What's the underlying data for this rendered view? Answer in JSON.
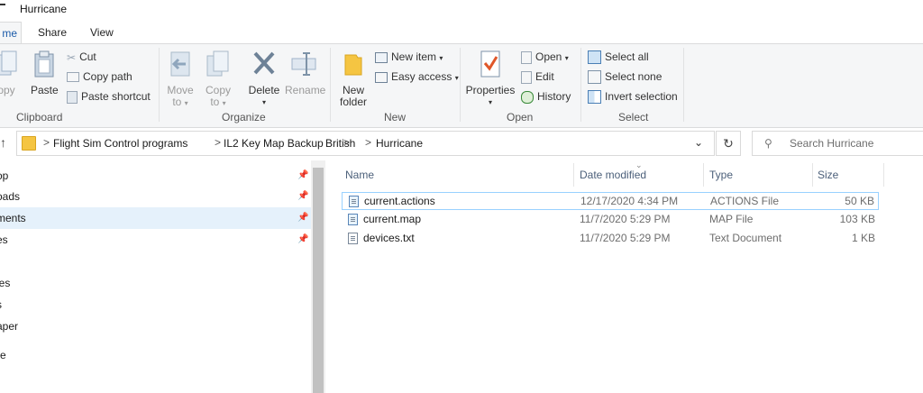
{
  "window": {
    "title": "Hurricane"
  },
  "tabs": {
    "home": "me",
    "share": "Share",
    "view": "View"
  },
  "ribbon": {
    "clipboard": {
      "label": "Clipboard",
      "copy": "opy",
      "paste": "Paste",
      "cut": "Cut",
      "copy_path": "Copy path",
      "paste_shortcut": "Paste shortcut"
    },
    "organize": {
      "label": "Organize",
      "move_to_1": "Move",
      "move_to_2": "to",
      "copy_to_1": "Copy",
      "copy_to_2": "to",
      "delete": "Delete",
      "rename": "Rename"
    },
    "new": {
      "label": "New",
      "new_folder_1": "New",
      "new_folder_2": "folder",
      "new_item": "New item",
      "easy_access": "Easy access"
    },
    "open": {
      "label": "Open",
      "properties": "Properties",
      "open": "Open",
      "edit": "Edit",
      "history": "History"
    },
    "select": {
      "label": "Select",
      "select_all": "Select all",
      "select_none": "Select none",
      "invert_selection": "Invert selection"
    }
  },
  "address": {
    "crumbs": [
      "Flight Sim Control programs",
      "IL2 Key Map Backup",
      "British",
      "Hurricane"
    ],
    "separator": ">"
  },
  "search": {
    "placeholder": "Search Hurricane"
  },
  "nav": {
    "items": [
      {
        "label": "op",
        "pinned": true
      },
      {
        "label": "oads",
        "pinned": true
      },
      {
        "label": "ments",
        "pinned": true,
        "selected": true
      },
      {
        "label": "es",
        "pinned": true
      },
      {
        "label": "les",
        "pinned": false
      },
      {
        "label": "s",
        "pinned": false
      },
      {
        "label": "aper",
        "pinned": false
      },
      {
        "label": "re",
        "pinned": false
      }
    ]
  },
  "files": {
    "columns": {
      "name": "Name",
      "date": "Date modified",
      "type": "Type",
      "size": "Size"
    },
    "rows": [
      {
        "name": "current.actions",
        "date": "12/17/2020 4:34 PM",
        "type": "ACTIONS File",
        "size": "50 KB"
      },
      {
        "name": "current.map",
        "date": "11/7/2020 5:29 PM",
        "type": "MAP File",
        "size": "103 KB"
      },
      {
        "name": "devices.txt",
        "date": "11/7/2020 5:29 PM",
        "type": "Text Document",
        "size": "1 KB"
      }
    ]
  }
}
